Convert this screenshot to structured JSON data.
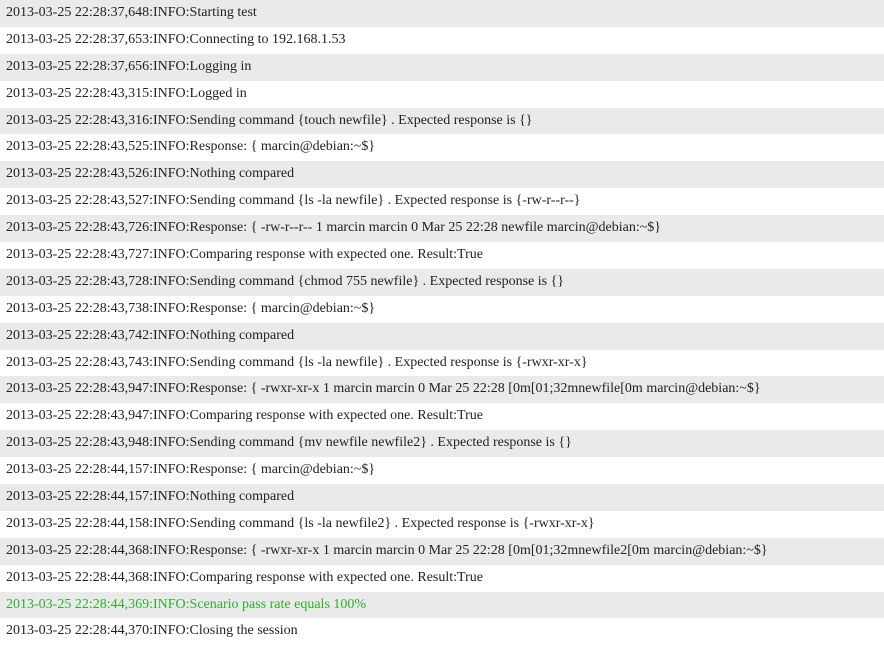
{
  "log": [
    {
      "text": "2013-03-25 22:28:37,648:INFO:Starting test",
      "success": false
    },
    {
      "text": "2013-03-25 22:28:37,653:INFO:Connecting to 192.168.1.53",
      "success": false
    },
    {
      "text": "2013-03-25 22:28:37,656:INFO:Logging in",
      "success": false
    },
    {
      "text": "2013-03-25 22:28:43,315:INFO:Logged in",
      "success": false
    },
    {
      "text": "2013-03-25 22:28:43,316:INFO:Sending command {touch newfile} . Expected response is {}",
      "success": false
    },
    {
      "text": "2013-03-25 22:28:43,525:INFO:Response: { marcin@debian:~$}",
      "success": false
    },
    {
      "text": "2013-03-25 22:28:43,526:INFO:Nothing compared",
      "success": false
    },
    {
      "text": "2013-03-25 22:28:43,527:INFO:Sending command {ls -la newfile} . Expected response is {-rw-r--r--}",
      "success": false
    },
    {
      "text": "2013-03-25 22:28:43,726:INFO:Response: { -rw-r--r-- 1 marcin marcin 0 Mar 25 22:28 newfile marcin@debian:~$}",
      "success": false
    },
    {
      "text": "2013-03-25 22:28:43,727:INFO:Comparing response with expected one. Result:True",
      "success": false
    },
    {
      "text": "2013-03-25 22:28:43,728:INFO:Sending command {chmod 755 newfile} . Expected response is {}",
      "success": false
    },
    {
      "text": "2013-03-25 22:28:43,738:INFO:Response: { marcin@debian:~$}",
      "success": false
    },
    {
      "text": "2013-03-25 22:28:43,742:INFO:Nothing compared",
      "success": false
    },
    {
      "text": "2013-03-25 22:28:43,743:INFO:Sending command {ls -la newfile} . Expected response is {-rwxr-xr-x}",
      "success": false
    },
    {
      "text": "2013-03-25 22:28:43,947:INFO:Response: { -rwxr-xr-x 1 marcin marcin 0 Mar 25 22:28 [0m[01;32mnewfile[0m marcin@debian:~$}",
      "success": false
    },
    {
      "text": "2013-03-25 22:28:43,947:INFO:Comparing response with expected one. Result:True",
      "success": false
    },
    {
      "text": "2013-03-25 22:28:43,948:INFO:Sending command {mv newfile newfile2} . Expected response is {}",
      "success": false
    },
    {
      "text": "2013-03-25 22:28:44,157:INFO:Response: { marcin@debian:~$}",
      "success": false
    },
    {
      "text": "2013-03-25 22:28:44,157:INFO:Nothing compared",
      "success": false
    },
    {
      "text": "2013-03-25 22:28:44,158:INFO:Sending command {ls -la newfile2} . Expected response is {-rwxr-xr-x}",
      "success": false
    },
    {
      "text": "2013-03-25 22:28:44,368:INFO:Response: { -rwxr-xr-x 1 marcin marcin 0 Mar 25 22:28 [0m[01;32mnewfile2[0m marcin@debian:~$}",
      "success": false
    },
    {
      "text": "2013-03-25 22:28:44,368:INFO:Comparing response with expected one. Result:True",
      "success": false
    },
    {
      "text": "2013-03-25 22:28:44,369:INFO:Scenario pass rate equals 100%",
      "success": true
    },
    {
      "text": "2013-03-25 22:28:44,370:INFO:Closing the session",
      "success": false
    }
  ]
}
